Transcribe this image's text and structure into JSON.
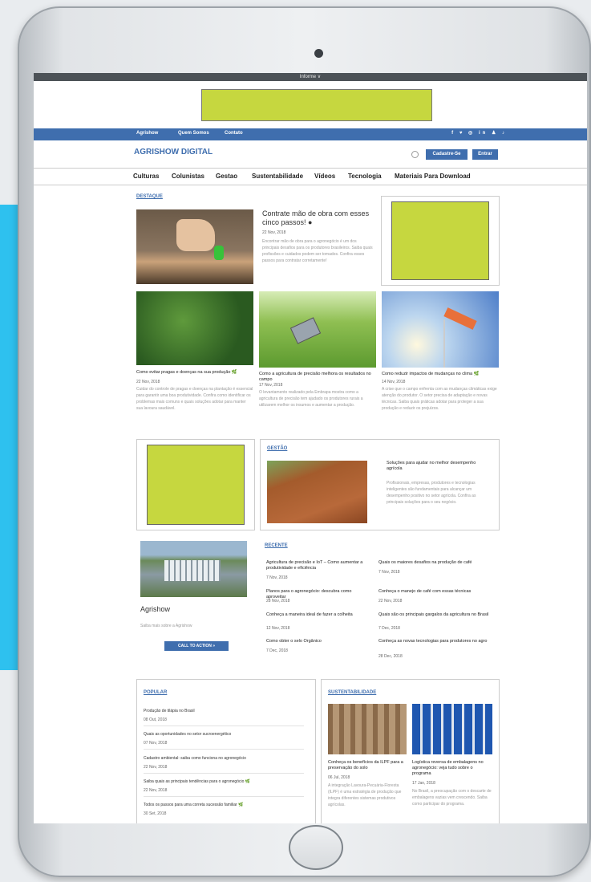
{
  "topbar": {
    "label": "Informe ∨"
  },
  "nav1": {
    "items": [
      "Agrishow",
      "Quem Somos",
      "Contato"
    ],
    "social": "f ♥ ◎ in ♟ ♪"
  },
  "header": {
    "logo": "AGRISHOW DIGITAL",
    "btn_subscribe": "Cadastre-Se",
    "btn_login": "Entrar"
  },
  "nav2": {
    "items": [
      "Culturas",
      "Colunistas",
      "Gestao",
      "Sustentabilidade",
      "Vídeos",
      "Tecnologia",
      "Materiais Para Download"
    ]
  },
  "destaque": {
    "section": "DESTAQUE",
    "main_title": "Contrate mão de obra com esses cinco passos! ●",
    "main_date": "22 Nov, 2018",
    "main_excerpt": "Encontrar mão de obra para o agronegócio é um dos principais desafios para os produtores brasileiros. Saiba quais profissões e cuidados podem ser tomados. Confira esses passos para contratar corretamente!",
    "cards": [
      {
        "title": "Como evitar pragas e doenças na sua produção 🌿",
        "date": "22 Nov, 2018",
        "excerpt": "Cuidar do controle de pragas e doenças na plantação é essencial para garantir uma boa produtividade. Confira como identificar os problemas mais comuns e quais soluções adotar para manter sua lavoura saudável."
      },
      {
        "title": "Como a agricultura de precisão melhora os resultados no campo",
        "date": "17 Nov, 2018",
        "excerpt": "O levantamento realizado pela Embrapa mostra como a agricultura de precisão tem ajudado os produtores rurais a utilizarem melhor os insumos e aumentar a produção."
      },
      {
        "title": "Como reduzir impactos de mudanças no clima 🌿",
        "date": "14 Nov, 2018",
        "excerpt": "A crise que o campo enfrenta com as mudanças climáticas exige atenção do produtor. O setor precisa de adaptação e novas técnicas. Saiba quais práticas adotar para proteger a sua produção e reduzir os prejuízos."
      }
    ]
  },
  "gestao": {
    "section": "GESTÃO",
    "title": "Soluções para ajudar no melhor desempenho agrícola",
    "excerpt": "Profissionais, empresas, produtores e tecnologias inteligentes são fundamentais para alcançar um desempenho positivo no setor agrícola. Confira as principais soluções para o seu negócio."
  },
  "agrishow": {
    "title": "Agrishow",
    "text": "Saiba mais sobre a Agrishow",
    "cta": "CALL TO ACTION »"
  },
  "recente": {
    "section": "RECENTE",
    "items": [
      {
        "title": "Agricultura de precisão e IoT – Como aumentar a produtividade e eficiência",
        "date": "7 Nov, 2018"
      },
      {
        "title": "Quais os maiores desafios na produção de café",
        "date": "7 Nov, 2018"
      },
      {
        "title": "Planos para o agronegócio: descubra como aproveitar",
        "date": "28 Nov, 2018"
      },
      {
        "title": "Conheça o manejo de café com essas técnicas",
        "date": "22 Nov, 2018"
      },
      {
        "title": "Conheça a maneira ideal de fazer a colheita",
        "date": "12 Nov, 2018"
      },
      {
        "title": "Quais são os principais gargalos da agricultura no Brasil",
        "date": "7 Dec, 2018"
      },
      {
        "title": "Como obter o selo Orgânico",
        "date": "7 Dec, 2018"
      },
      {
        "title": "Conheça as novas tecnologias para produtores no agro",
        "date": "28 Dec, 2018"
      }
    ]
  },
  "popular": {
    "section": "POPULAR",
    "items": [
      {
        "title": "Produção de tilápia no Brasil",
        "date": "08 Out, 2018"
      },
      {
        "title": "Quais as oportunidades no setor sucroenergético",
        "date": "07 Nov, 2018"
      },
      {
        "title": "Cadastro ambiental: saiba como funciona no agronegócio",
        "date": "22 Nov, 2018"
      },
      {
        "title": "Saiba quais as principais tendências para o agronegócio 🌿",
        "date": "22 Nov, 2018"
      },
      {
        "title": "Todos os passos para uma correta sucessão familiar 🌿",
        "date": "30 Set, 2018"
      }
    ]
  },
  "sustentabilidade": {
    "section": "SUSTENTABILIDADE",
    "cards": [
      {
        "title": "Conheça os benefícios da ILPF para a preservação do solo",
        "date": "06 Jul, 2018",
        "excerpt": "A integração Lavoura-Pecuária-Floresta (ILPF) é uma estratégia de produção que integra diferentes sistemas produtivos agrícolas."
      },
      {
        "title": "Logística reversa de embalagens no agronegócio: veja tudo sobre o programa",
        "date": "17 Jan, 2018",
        "excerpt": "No Brasil, a preocupação com o descarte de embalagens vazias vem crescendo. Saiba como participar do programa."
      }
    ]
  }
}
